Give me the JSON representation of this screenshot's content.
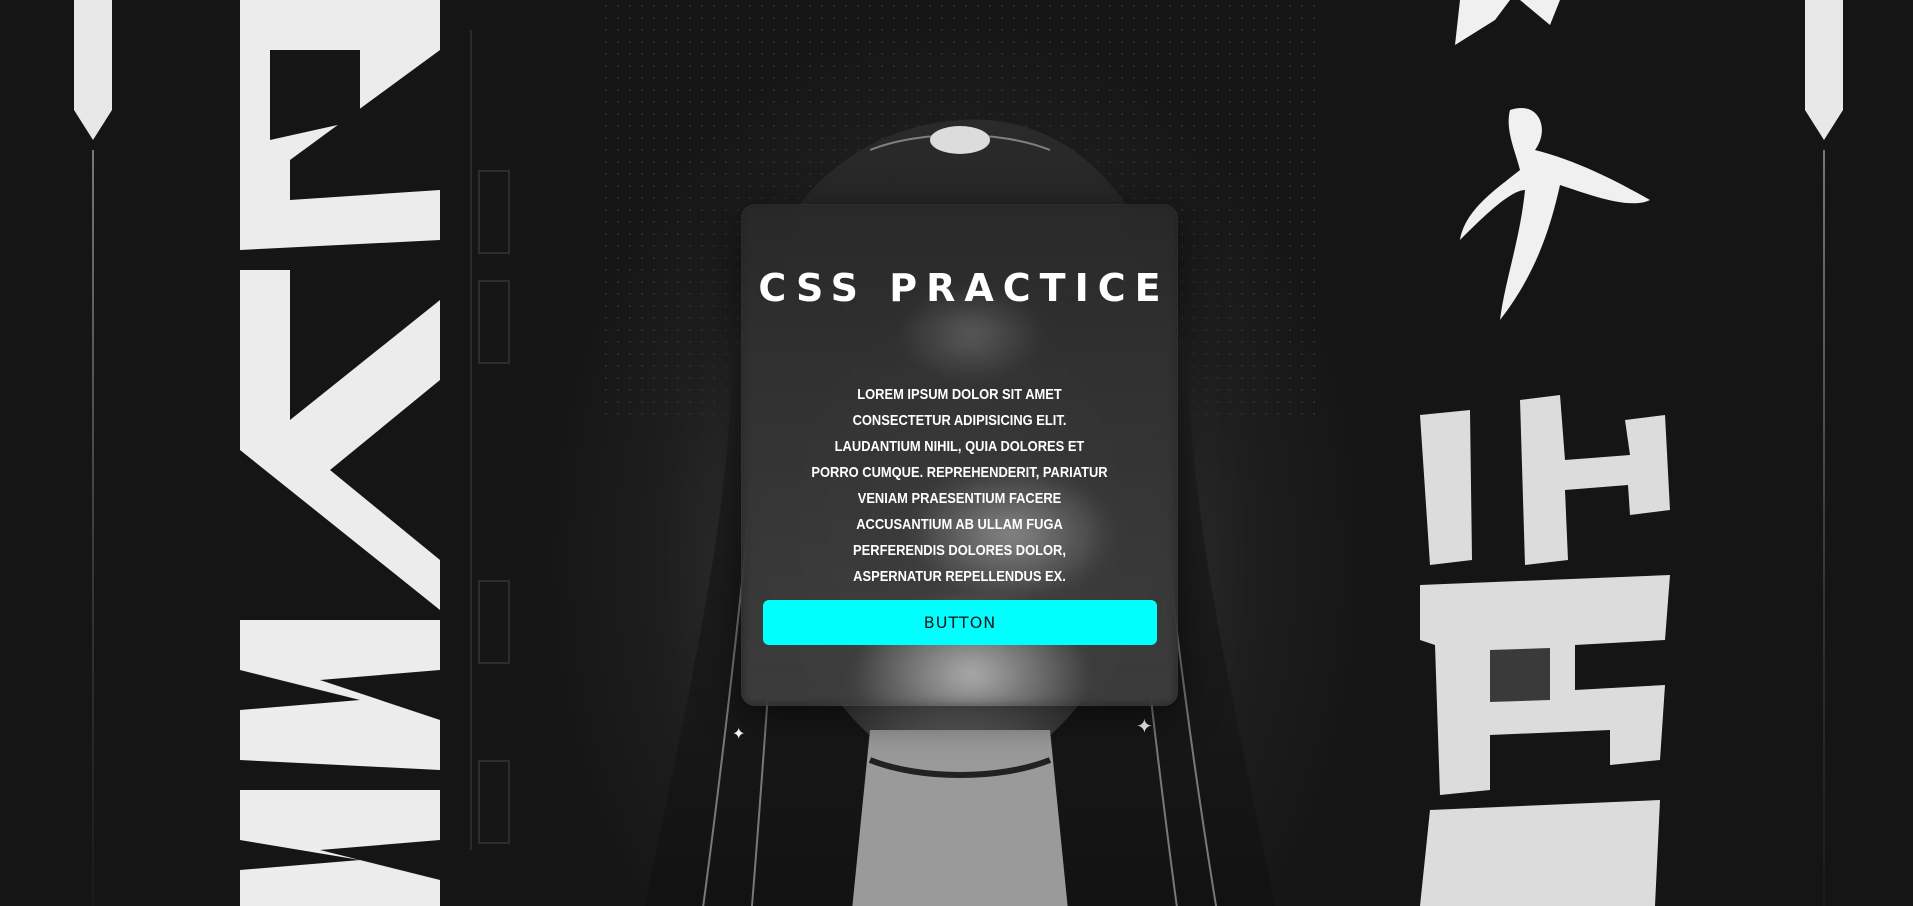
{
  "card": {
    "title": "CSS PRACTICE",
    "body": "Lorem ipsum dolor sit amet consectetur adipisicing elit. Laudantium nihil, quia dolores et porro cumque. Reprehenderit, pariatur veniam praesentium facere accusantium ab ullam fuga perferendis dolores dolor, aspernatur repellendus ex.",
    "button_label": "BUTTON"
  },
  "colors": {
    "accent": "#00ffff",
    "background": "#151515",
    "card_text": "#ffffff"
  },
  "decor": {
    "left_pillar": "pillar-icon",
    "right_pillar": "pillar-icon",
    "sparkle": "sparkle-icon"
  }
}
